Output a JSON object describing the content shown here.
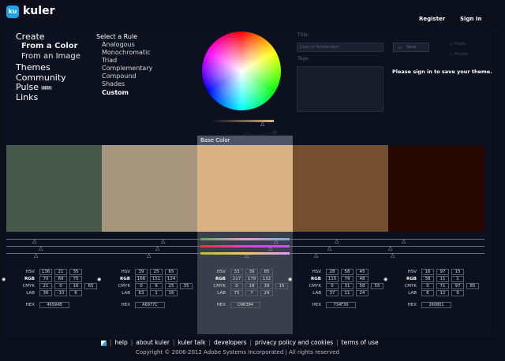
{
  "app": {
    "logo_badge": "ku",
    "name": "kuler",
    "register": "Register",
    "signin": "Sign In"
  },
  "nav": {
    "create": "Create",
    "from_color": "From a Color",
    "from_image": "From an Image",
    "themes": "Themes",
    "community": "Community",
    "pulse": "Pulse",
    "pulse_badge": "BETA",
    "links": "Links"
  },
  "rules": {
    "title": "Select a Rule",
    "items": [
      "Analogous",
      "Monochromatic",
      "Triad",
      "Complementary",
      "Compound",
      "Shades",
      "Custom"
    ],
    "selected": "Custom"
  },
  "form": {
    "title_label": "Title:",
    "title_value": "Copy of Amsterdam",
    "tags_label": "Tags:",
    "save": "Save",
    "public": "Public",
    "private": "Private",
    "signin_msg": "Please sign in to save your theme."
  },
  "base_color_label": "Base Color",
  "swatches": [
    {
      "hex": "46594B",
      "color": "#46594b",
      "hsv": [
        "136",
        "21",
        "35"
      ],
      "rgb": [
        "70",
        "89",
        "75"
      ],
      "cmyk": [
        "21",
        "0",
        "16",
        "65"
      ],
      "lab": [
        "36",
        "-10",
        "6"
      ]
    },
    {
      "hex": "A6977C",
      "color": "#a6977c",
      "hsv": [
        "39",
        "25",
        "65"
      ],
      "rgb": [
        "166",
        "151",
        "124"
      ],
      "cmyk": [
        "0",
        "9",
        "25",
        "35"
      ],
      "lab": [
        "63",
        "1",
        "16"
      ]
    },
    {
      "hex": "D9B384",
      "color": "#d9b384",
      "hsv": [
        "33",
        "39",
        "85"
      ],
      "rgb": [
        "217",
        "179",
        "132"
      ],
      "cmyk": [
        "0",
        "18",
        "39",
        "15"
      ],
      "lab": [
        "75",
        "7",
        "29"
      ]
    },
    {
      "hex": "734F30",
      "color": "#734f30",
      "hsv": [
        "28",
        "58",
        "45"
      ],
      "rgb": [
        "115",
        "79",
        "48"
      ],
      "cmyk": [
        "0",
        "31",
        "58",
        "55"
      ],
      "lab": [
        "37",
        "11",
        "24"
      ]
    },
    {
      "hex": "260801",
      "color": "#260801",
      "hsv": [
        "16",
        "97",
        "15"
      ],
      "rgb": [
        "38",
        "11",
        "1"
      ],
      "cmyk": [
        "0",
        "71",
        "97",
        "85"
      ],
      "lab": [
        "6",
        "12",
        "9"
      ]
    }
  ],
  "labels": {
    "hsv": "HSV",
    "rgb": "RGB",
    "cmyk": "CMYK",
    "lab": "LAB",
    "hex": "HEX"
  },
  "footer": {
    "links": [
      "help",
      "about kuler",
      "kuler talk",
      "developers",
      "privacy policy and cookies",
      "terms of use"
    ],
    "copyright": "Copyright © 2006-2012 Adobe Systems Incorporated | All rights reserved"
  }
}
